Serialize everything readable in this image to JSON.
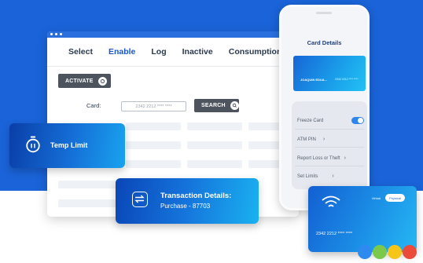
{
  "window": {
    "tabs": [
      {
        "label": "Select",
        "active": false
      },
      {
        "label": "Enable",
        "active": true
      },
      {
        "label": "Log",
        "active": false
      },
      {
        "label": "Inactive",
        "active": false
      },
      {
        "label": "Consumption",
        "active": false
      }
    ],
    "activate_label": "ACTIVATE",
    "card_label": "Card:",
    "card_input_value": "2342 2212 **** ****",
    "search_label": "SEARCH"
  },
  "phone": {
    "title": "Card Details",
    "mini_card": {
      "holder": "JOAQUIN EDUA...",
      "number": "2342 2212 **** ****"
    },
    "settings": [
      {
        "label": "Freeze Card",
        "type": "toggle",
        "on": true
      },
      {
        "label": "ATM PIN",
        "type": "chevron"
      },
      {
        "label": "Report Loss or Theft",
        "type": "chevron"
      },
      {
        "label": "Set Limits",
        "type": "chevron"
      }
    ]
  },
  "temp_limit": {
    "label": "Temp Limit"
  },
  "transaction": {
    "title": "Transaction Details:",
    "subtitle": "Purchase - 87703"
  },
  "credit_card": {
    "number": "2342 2212 **** ****",
    "virtual_label": "Virtual",
    "physical_label": "Physical"
  },
  "colors": {
    "background_blue": "#1a63d8",
    "brand_blue": "#1a56c8",
    "button_dark": "#4d545d",
    "dots": [
      "#2f8af0",
      "#7bc94a",
      "#f5c518",
      "#ea4b3a"
    ]
  }
}
